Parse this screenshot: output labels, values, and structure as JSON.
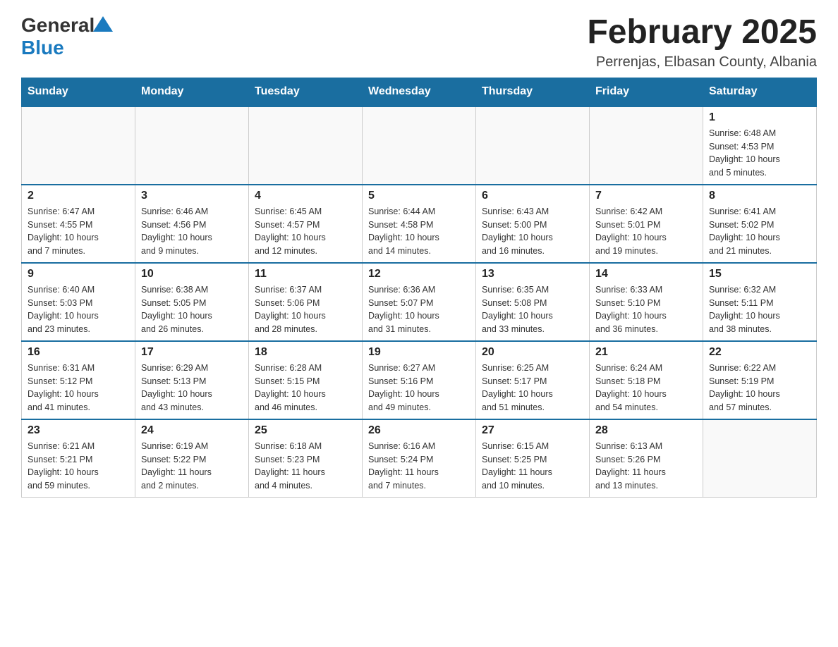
{
  "logo": {
    "general": "General",
    "blue": "Blue"
  },
  "title": "February 2025",
  "location": "Perrenjas, Elbasan County, Albania",
  "weekdays": [
    "Sunday",
    "Monday",
    "Tuesday",
    "Wednesday",
    "Thursday",
    "Friday",
    "Saturday"
  ],
  "weeks": [
    [
      {
        "day": "",
        "info": ""
      },
      {
        "day": "",
        "info": ""
      },
      {
        "day": "",
        "info": ""
      },
      {
        "day": "",
        "info": ""
      },
      {
        "day": "",
        "info": ""
      },
      {
        "day": "",
        "info": ""
      },
      {
        "day": "1",
        "info": "Sunrise: 6:48 AM\nSunset: 4:53 PM\nDaylight: 10 hours\nand 5 minutes."
      }
    ],
    [
      {
        "day": "2",
        "info": "Sunrise: 6:47 AM\nSunset: 4:55 PM\nDaylight: 10 hours\nand 7 minutes."
      },
      {
        "day": "3",
        "info": "Sunrise: 6:46 AM\nSunset: 4:56 PM\nDaylight: 10 hours\nand 9 minutes."
      },
      {
        "day": "4",
        "info": "Sunrise: 6:45 AM\nSunset: 4:57 PM\nDaylight: 10 hours\nand 12 minutes."
      },
      {
        "day": "5",
        "info": "Sunrise: 6:44 AM\nSunset: 4:58 PM\nDaylight: 10 hours\nand 14 minutes."
      },
      {
        "day": "6",
        "info": "Sunrise: 6:43 AM\nSunset: 5:00 PM\nDaylight: 10 hours\nand 16 minutes."
      },
      {
        "day": "7",
        "info": "Sunrise: 6:42 AM\nSunset: 5:01 PM\nDaylight: 10 hours\nand 19 minutes."
      },
      {
        "day": "8",
        "info": "Sunrise: 6:41 AM\nSunset: 5:02 PM\nDaylight: 10 hours\nand 21 minutes."
      }
    ],
    [
      {
        "day": "9",
        "info": "Sunrise: 6:40 AM\nSunset: 5:03 PM\nDaylight: 10 hours\nand 23 minutes."
      },
      {
        "day": "10",
        "info": "Sunrise: 6:38 AM\nSunset: 5:05 PM\nDaylight: 10 hours\nand 26 minutes."
      },
      {
        "day": "11",
        "info": "Sunrise: 6:37 AM\nSunset: 5:06 PM\nDaylight: 10 hours\nand 28 minutes."
      },
      {
        "day": "12",
        "info": "Sunrise: 6:36 AM\nSunset: 5:07 PM\nDaylight: 10 hours\nand 31 minutes."
      },
      {
        "day": "13",
        "info": "Sunrise: 6:35 AM\nSunset: 5:08 PM\nDaylight: 10 hours\nand 33 minutes."
      },
      {
        "day": "14",
        "info": "Sunrise: 6:33 AM\nSunset: 5:10 PM\nDaylight: 10 hours\nand 36 minutes."
      },
      {
        "day": "15",
        "info": "Sunrise: 6:32 AM\nSunset: 5:11 PM\nDaylight: 10 hours\nand 38 minutes."
      }
    ],
    [
      {
        "day": "16",
        "info": "Sunrise: 6:31 AM\nSunset: 5:12 PM\nDaylight: 10 hours\nand 41 minutes."
      },
      {
        "day": "17",
        "info": "Sunrise: 6:29 AM\nSunset: 5:13 PM\nDaylight: 10 hours\nand 43 minutes."
      },
      {
        "day": "18",
        "info": "Sunrise: 6:28 AM\nSunset: 5:15 PM\nDaylight: 10 hours\nand 46 minutes."
      },
      {
        "day": "19",
        "info": "Sunrise: 6:27 AM\nSunset: 5:16 PM\nDaylight: 10 hours\nand 49 minutes."
      },
      {
        "day": "20",
        "info": "Sunrise: 6:25 AM\nSunset: 5:17 PM\nDaylight: 10 hours\nand 51 minutes."
      },
      {
        "day": "21",
        "info": "Sunrise: 6:24 AM\nSunset: 5:18 PM\nDaylight: 10 hours\nand 54 minutes."
      },
      {
        "day": "22",
        "info": "Sunrise: 6:22 AM\nSunset: 5:19 PM\nDaylight: 10 hours\nand 57 minutes."
      }
    ],
    [
      {
        "day": "23",
        "info": "Sunrise: 6:21 AM\nSunset: 5:21 PM\nDaylight: 10 hours\nand 59 minutes."
      },
      {
        "day": "24",
        "info": "Sunrise: 6:19 AM\nSunset: 5:22 PM\nDaylight: 11 hours\nand 2 minutes."
      },
      {
        "day": "25",
        "info": "Sunrise: 6:18 AM\nSunset: 5:23 PM\nDaylight: 11 hours\nand 4 minutes."
      },
      {
        "day": "26",
        "info": "Sunrise: 6:16 AM\nSunset: 5:24 PM\nDaylight: 11 hours\nand 7 minutes."
      },
      {
        "day": "27",
        "info": "Sunrise: 6:15 AM\nSunset: 5:25 PM\nDaylight: 11 hours\nand 10 minutes."
      },
      {
        "day": "28",
        "info": "Sunrise: 6:13 AM\nSunset: 5:26 PM\nDaylight: 11 hours\nand 13 minutes."
      },
      {
        "day": "",
        "info": ""
      }
    ]
  ],
  "colors": {
    "header_bg": "#1a6ea0",
    "header_text": "#ffffff",
    "border": "#1a6ea0"
  }
}
